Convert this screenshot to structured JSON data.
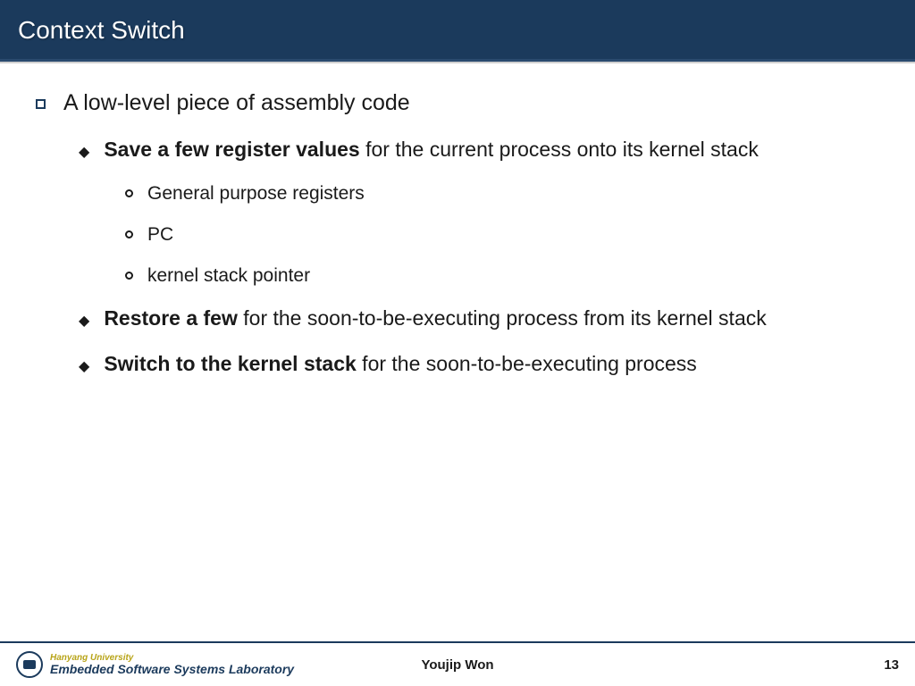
{
  "header": {
    "title": "Context Switch"
  },
  "content": {
    "l1": "A low-level piece of assembly code",
    "l2a_bold": "Save a few register values",
    "l2a_rest": " for the current process onto its kernel stack",
    "l3a": "General purpose registers",
    "l3b": "PC",
    "l3c": "kernel stack pointer",
    "l2b_bold": "Restore a few",
    "l2b_rest": " for the soon-to-be-executing process from its kernel stack",
    "l2c_bold": "Switch to the kernel stack",
    "l2c_rest": " for the soon-to-be-executing process"
  },
  "footer": {
    "university": "Hanyang University",
    "lab": "Embedded Software Systems Laboratory",
    "author": "Youjip Won",
    "page": "13"
  }
}
